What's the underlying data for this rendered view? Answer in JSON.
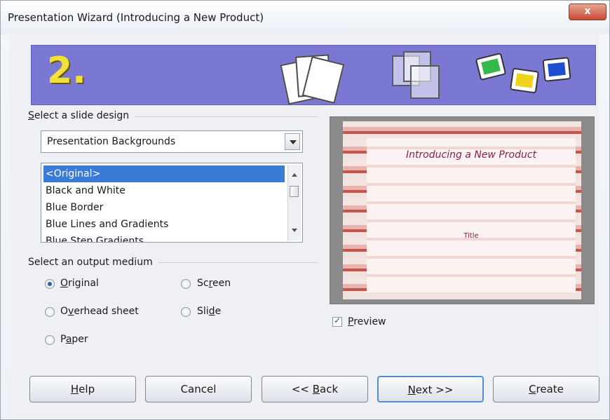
{
  "window": {
    "title": "Presentation Wizard (Introducing a New Product)",
    "close_glyph": "x"
  },
  "banner": {
    "step": "2.",
    "color": "#7b78d3"
  },
  "design": {
    "group_label": "Select a slide design",
    "group_label_pre": "",
    "group_label_ul": "S",
    "group_label_post": "elect a slide design",
    "category": "Presentation Backgrounds",
    "items": [
      "<Original>",
      "Black and White",
      "Blue Border",
      "Blue Lines and Gradients",
      "Blue Step Gradients"
    ],
    "selected": "<Original>"
  },
  "output": {
    "group_label": "Select an output medium",
    "options": [
      {
        "pre": "",
        "ul": "O",
        "post": "riginal",
        "checked": true
      },
      {
        "pre": "Sc",
        "ul": "r",
        "post": "een",
        "checked": false
      },
      {
        "pre": "O",
        "ul": "v",
        "post": "erhead sheet",
        "checked": false
      },
      {
        "pre": "Sli",
        "ul": "d",
        "post": "e",
        "checked": false
      },
      {
        "pre": "P",
        "ul": "a",
        "post": "per",
        "checked": false
      }
    ]
  },
  "preview": {
    "slide_title": "Introducing a New Product",
    "slide_subtitle": "Title",
    "checkbox_ul": "P",
    "checkbox_post": "review",
    "checked": true
  },
  "buttons": {
    "help_ul": "H",
    "help_post": "elp",
    "cancel": "Cancel",
    "back_pre": "<< ",
    "back_ul": "B",
    "back_post": "ack",
    "next_ul": "N",
    "next_post": "ext >>",
    "create_ul": "C",
    "create_post": "reate"
  },
  "icons": [
    "pages-icon",
    "overlapping-frames-icon",
    "color-slides-icon"
  ]
}
